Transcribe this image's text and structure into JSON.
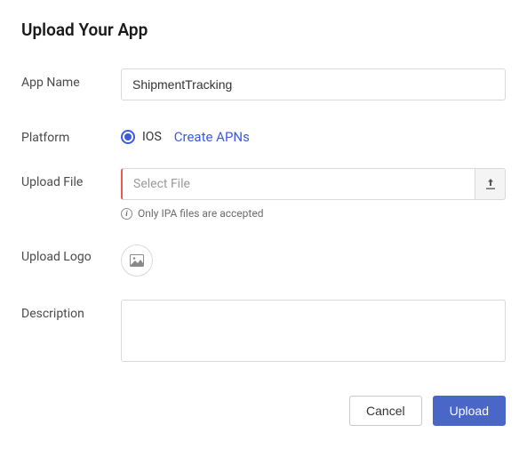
{
  "title": "Upload Your App",
  "labels": {
    "app_name": "App Name",
    "platform": "Platform",
    "upload_file": "Upload File",
    "upload_logo": "Upload Logo",
    "description": "Description"
  },
  "app_name_value": "ShipmentTracking",
  "platform": {
    "selected_label": "IOS",
    "link_label": "Create APNs"
  },
  "upload_file": {
    "placeholder": "Select File",
    "hint": "Only IPA files are accepted"
  },
  "description_value": "",
  "buttons": {
    "cancel": "Cancel",
    "upload": "Upload"
  }
}
